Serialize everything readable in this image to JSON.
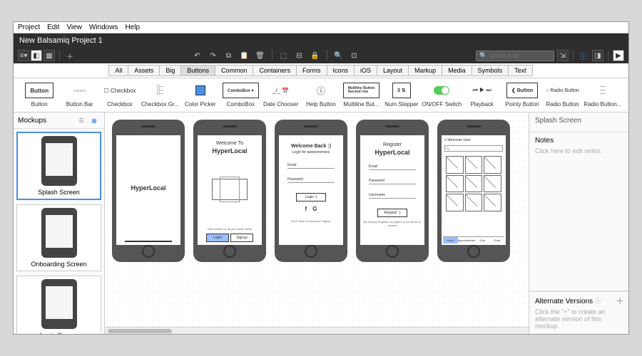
{
  "menubar": [
    "Project",
    "Edit",
    "View",
    "Windows",
    "Help"
  ],
  "title": "New Balsamiq Project 1",
  "quick_add_placeholder": "Quick Add",
  "categories": [
    "All",
    "Assets",
    "Big",
    "Buttons",
    "Common",
    "Containers",
    "Forms",
    "Icons",
    "iOS",
    "Layout",
    "Markup",
    "Media",
    "Symbols",
    "Text"
  ],
  "active_category": "Buttons",
  "tools": [
    {
      "label": "Button"
    },
    {
      "label": "Button Bar"
    },
    {
      "label": "Checkbox"
    },
    {
      "label": "Checkbox Gr..."
    },
    {
      "label": "Color Picker"
    },
    {
      "label": "ComboBox"
    },
    {
      "label": "Date Chooser"
    },
    {
      "label": "Help Button"
    },
    {
      "label": "Multiline But..."
    },
    {
      "label": "Num Stepper"
    },
    {
      "label": "ON/OFF Switch"
    },
    {
      "label": "Playback"
    },
    {
      "label": "Pointy Button"
    },
    {
      "label": "Radio Button"
    },
    {
      "label": "Radio Button..."
    }
  ],
  "sidebar": {
    "title": "Mockups",
    "items": [
      {
        "label": "Splash Screen",
        "selected": true
      },
      {
        "label": "Onboarding Screen",
        "selected": false
      },
      {
        "label": "Login Screen",
        "selected": false
      }
    ]
  },
  "canvas": {
    "phones": [
      {
        "kind": "brand",
        "brand": "HyperLocal"
      },
      {
        "kind": "onboard",
        "title": "Welcome To",
        "brand": "HyperLocal",
        "caption": "One solution to all your local needs",
        "primary": "Login",
        "secondary": "Signup"
      },
      {
        "kind": "login",
        "title": "Welcome Back :)",
        "sub": "Login for awesomeness",
        "fields": [
          "Email",
          "Password"
        ],
        "btn": "Login :)",
        "caption": "Don't have an account? Signup"
      },
      {
        "kind": "register",
        "title": "Register",
        "brand": "HyperLocal",
        "fields": [
          "Email",
          "Password",
          "Username"
        ],
        "btn": "Register :)",
        "caption": "By clicking Register you agree to our terms of service"
      },
      {
        "kind": "home",
        "tabs": [
          "Home",
          "Appointments",
          "Cart",
          "Chat"
        ]
      }
    ]
  },
  "inspector": {
    "title": "Splash Screen",
    "notes_label": "Notes",
    "notes_placeholder": "Click here to edit notes.",
    "alt_title": "Alternate Versions",
    "alt_hint": "Click the \"+\" to create an alternate version of this mockup."
  }
}
